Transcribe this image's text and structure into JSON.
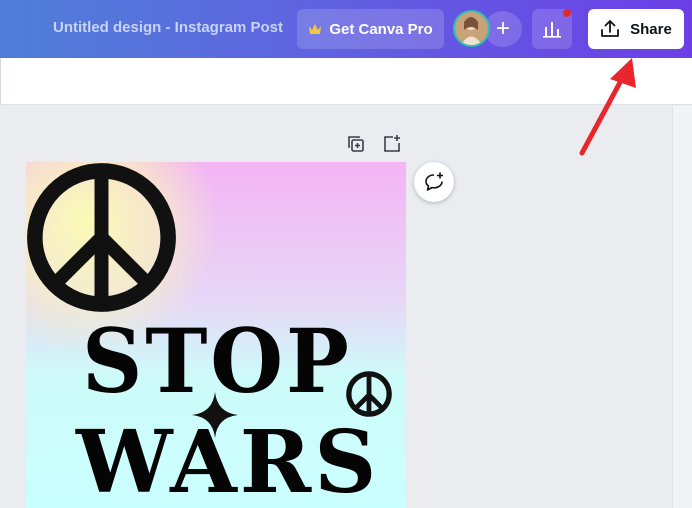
{
  "header": {
    "design_title": "Untitled design - Instagram Post",
    "pro_label": "Get Canva Pro",
    "add_label": "+",
    "share_label": "Share"
  },
  "canvas": {
    "line1": "STOP",
    "line2": "WARS"
  },
  "icons": {
    "crown": "crown-icon",
    "stats": "bar-chart-icon",
    "share": "upload-icon",
    "duplicate": "duplicate-page-icon",
    "add_page": "add-page-icon",
    "comment": "add-comment-icon",
    "peace": "peace-sign-icon"
  },
  "colors": {
    "header_gradient_start": "#4f7fd8",
    "header_gradient_end": "#6c3fe6",
    "crown": "#f5c542",
    "notification_dot": "#e0292c",
    "arrow": "#e8262b"
  }
}
